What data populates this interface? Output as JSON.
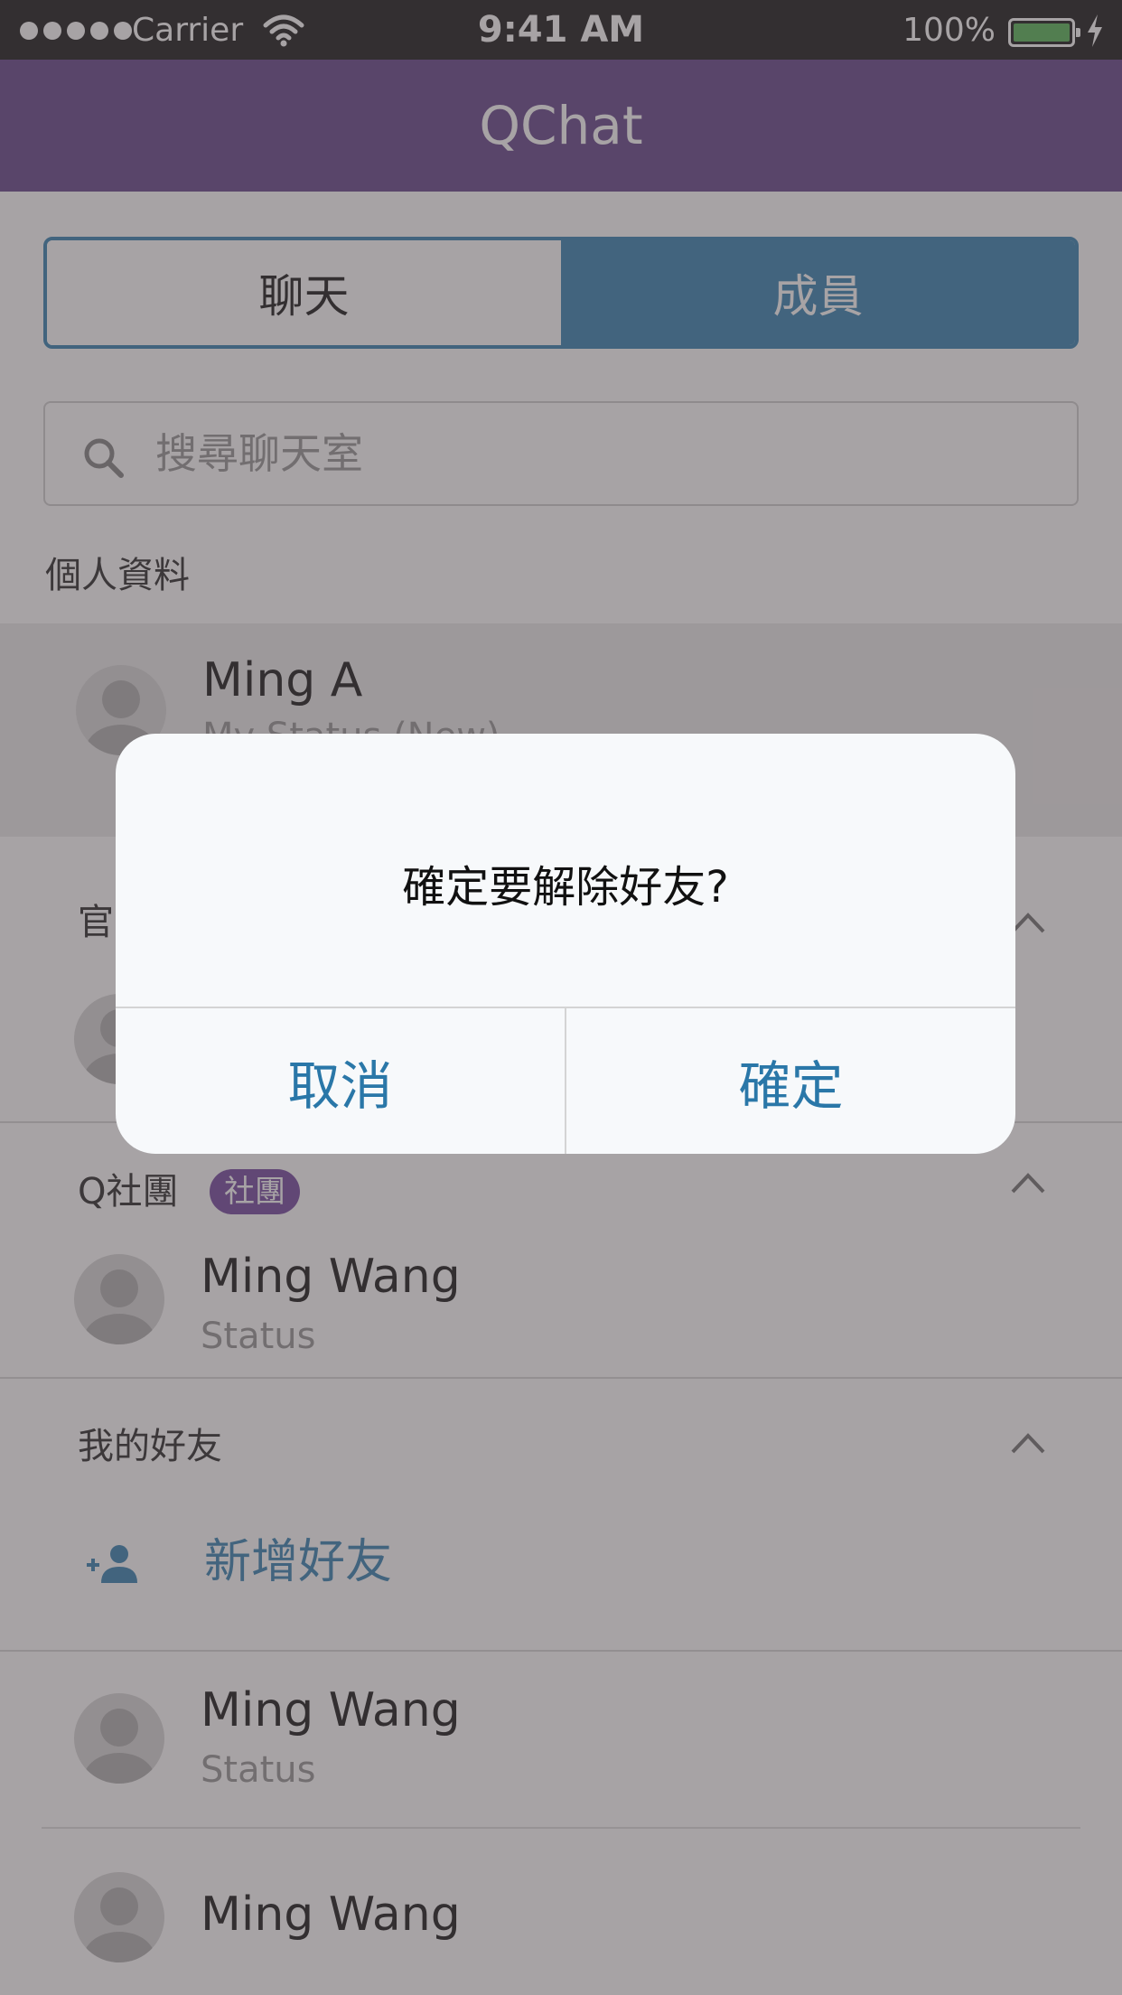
{
  "status_bar": {
    "carrier": "Carrier",
    "time": "9:41 AM",
    "battery": "100%",
    "battery_level_percent": 100,
    "signal_bars": 5
  },
  "header": {
    "title": "QChat"
  },
  "segmented_control": {
    "tabs": [
      {
        "label": "聊天",
        "selected": false
      },
      {
        "label": "成員",
        "selected": true
      }
    ]
  },
  "search": {
    "placeholder": "搜尋聊天室"
  },
  "profile_section": {
    "label": "個人資料",
    "name": "Ming A",
    "status": "My Status (New)"
  },
  "official_section": {
    "label": "官"
  },
  "club_section": {
    "label": "Q社團",
    "badge": "社團",
    "member": {
      "name": "Ming Wang",
      "status": "Status"
    }
  },
  "friends_section": {
    "label": "我的好友",
    "add_friend": "新增好友",
    "friends": [
      {
        "name": "Ming Wang",
        "status": "Status"
      },
      {
        "name": "Ming Wang"
      }
    ]
  },
  "dialog": {
    "message": "確定要解除好友?",
    "cancel": "取消",
    "confirm": "確定"
  },
  "colors": {
    "header": "#6a4c8e",
    "accent": "#3f87b5",
    "badge": "#7a4fa3",
    "dialog_button": "#2a77a8"
  },
  "icons": [
    "wifi-icon",
    "battery-icon",
    "bolt-icon",
    "search-icon",
    "avatar-icon",
    "chevron-up-icon",
    "add-friend-icon"
  ]
}
